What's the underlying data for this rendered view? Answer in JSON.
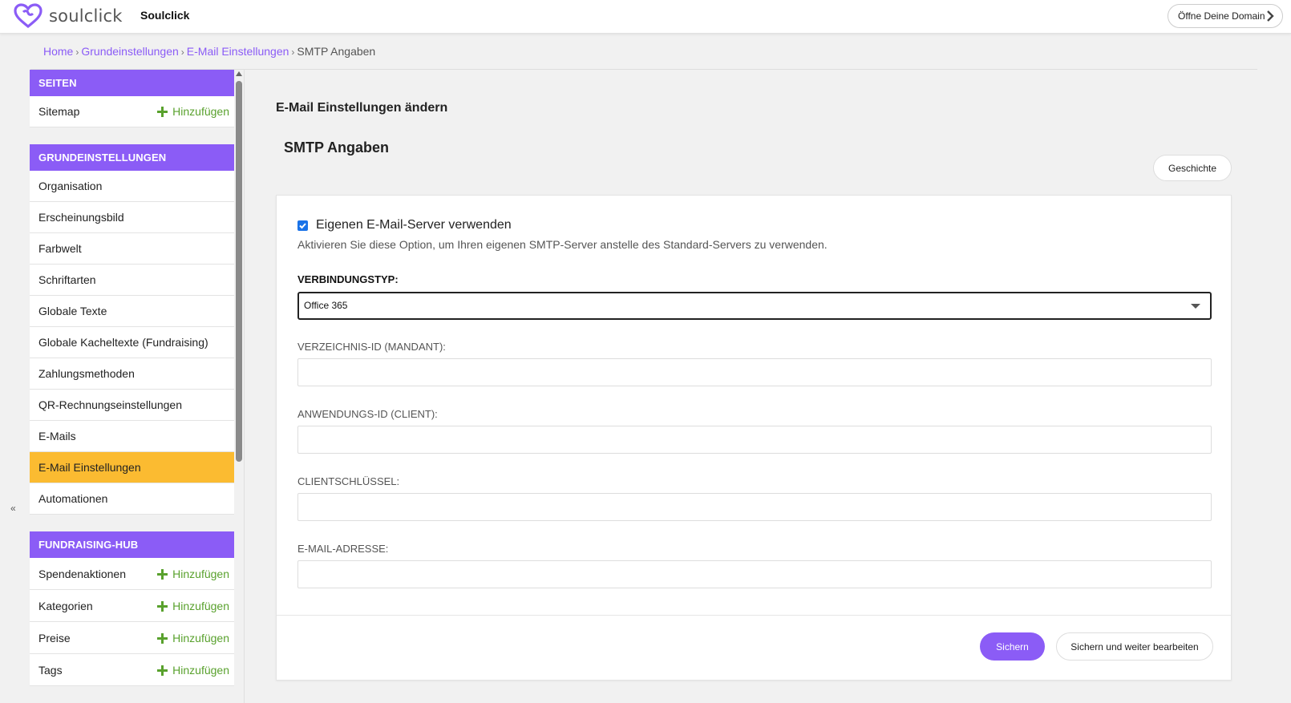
{
  "header": {
    "logo_text": "soulclick",
    "site_name": "Soulclick",
    "domain_button": "Öffne Deine Domain",
    "brand_color": "#8b5cf6"
  },
  "breadcrumb": {
    "items": [
      "Home",
      "Grundeinstellungen",
      "E-Mail Einstellungen"
    ],
    "current": "SMTP Angaben",
    "separator": "›"
  },
  "sidebar": {
    "collapse_label": "«",
    "sections": [
      {
        "title": "SEITEN",
        "items": [
          {
            "label": "Sitemap",
            "add_label": "Hinzufügen"
          }
        ]
      },
      {
        "title": "GRUNDEINSTELLUNGEN",
        "items": [
          {
            "label": "Organisation"
          },
          {
            "label": "Erscheinungsbild"
          },
          {
            "label": "Farbwelt"
          },
          {
            "label": "Schriftarten"
          },
          {
            "label": "Globale Texte"
          },
          {
            "label": "Globale Kacheltexte (Fundraising)"
          },
          {
            "label": "Zahlungsmethoden"
          },
          {
            "label": "QR-Rechnungseinstellungen"
          },
          {
            "label": "E-Mails"
          },
          {
            "label": "E-Mail Einstellungen",
            "active": true
          },
          {
            "label": "Automationen"
          }
        ]
      },
      {
        "title": "FUNDRAISING-HUB",
        "items": [
          {
            "label": "Spendenaktionen",
            "add_label": "Hinzufügen"
          },
          {
            "label": "Kategorien",
            "add_label": "Hinzufügen"
          },
          {
            "label": "Preise",
            "add_label": "Hinzufügen"
          },
          {
            "label": "Tags",
            "add_label": "Hinzufügen"
          }
        ]
      }
    ],
    "active_color": "#fbbb31",
    "add_color": "#59a12d"
  },
  "main": {
    "title": "E-Mail Einstellungen ändern",
    "subtitle": "SMTP Angaben",
    "history_button": "Geschichte",
    "form": {
      "use_own_server_label": "Eigenen E-Mail-Server verwenden",
      "use_own_server_checked": true,
      "help_text": "Aktivieren Sie diese Option, um Ihren eigenen SMTP-Server anstelle des Standard-Servers zu verwenden.",
      "connection_type_label": "VERBINDUNGSTYP:",
      "connection_type_value": "Office 365",
      "tenant_label": "VERZEICHNIS-ID (MANDANT):",
      "tenant_value": "",
      "client_label": "ANWENDUNGS-ID (CLIENT):",
      "client_value": "",
      "secret_label": "CLIENTSCHLÜSSEL:",
      "secret_value": "",
      "email_label": "E-MAIL-ADRESSE:",
      "email_value": ""
    },
    "save_button": "Sichern",
    "save_continue_button": "Sichern und weiter bearbeiten"
  }
}
